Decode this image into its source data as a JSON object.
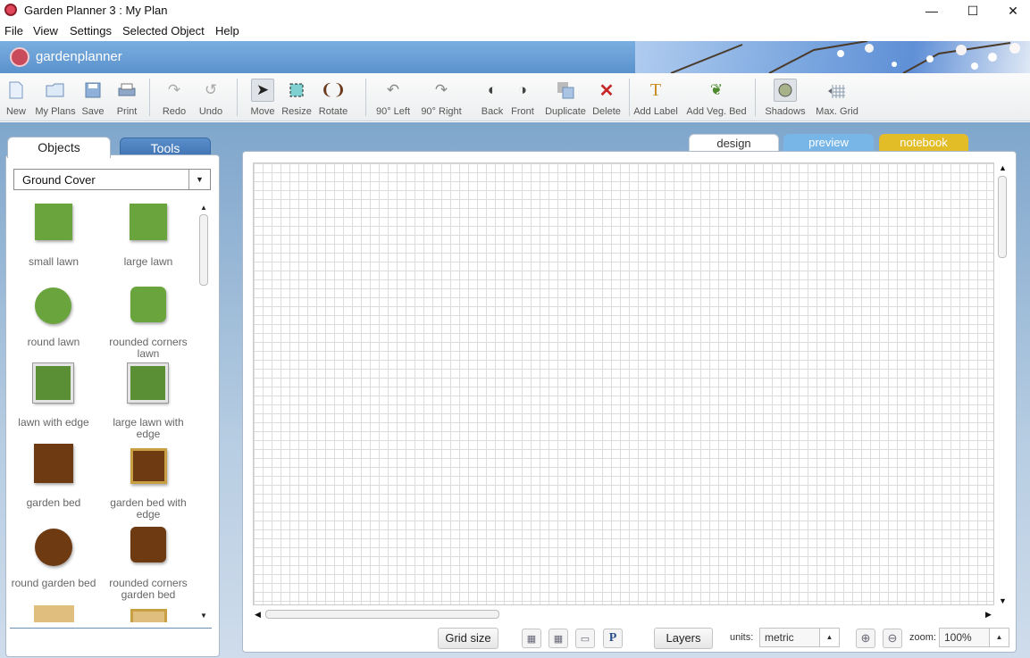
{
  "window": {
    "title": "Garden Planner 3 : My  Plan",
    "minimize": "—",
    "maximize": "☐",
    "close": "✕"
  },
  "menu": [
    "File",
    "View",
    "Settings",
    "Selected Object",
    "Help"
  ],
  "brand": {
    "name": "gardenplanner"
  },
  "toolbar": [
    {
      "label": "New",
      "icon": "new-document-icon"
    },
    {
      "label": "My Plans",
      "icon": "folder-icon"
    },
    {
      "label": "Save",
      "icon": "floppy-disk-icon"
    },
    {
      "label": "Print",
      "icon": "printer-icon"
    },
    {
      "label": "Redo",
      "icon": "redo-icon"
    },
    {
      "label": "Undo",
      "icon": "undo-icon"
    },
    {
      "label": "Move",
      "icon": "cursor-arrow-icon"
    },
    {
      "label": "Resize",
      "icon": "resize-icon"
    },
    {
      "label": "Rotate",
      "icon": "rotate-icon"
    },
    {
      "label": "90° Left",
      "icon": "rotate-left-icon"
    },
    {
      "label": "90° Right",
      "icon": "rotate-right-icon"
    },
    {
      "label": "Back",
      "icon": "send-back-icon"
    },
    {
      "label": "Front",
      "icon": "bring-front-icon"
    },
    {
      "label": "Duplicate",
      "icon": "duplicate-icon"
    },
    {
      "label": "Delete",
      "icon": "delete-x-icon"
    },
    {
      "label": "Add Label",
      "icon": "text-t-icon"
    },
    {
      "label": "Add Veg. Bed",
      "icon": "vegetable-bed-icon"
    },
    {
      "label": "Shadows",
      "icon": "shadow-circle-icon"
    },
    {
      "label": "Max. Grid",
      "icon": "max-grid-icon"
    }
  ],
  "panel_tabs": {
    "objects": "Objects",
    "tools": "Tools"
  },
  "category": {
    "selected": "Ground Cover"
  },
  "objects": [
    {
      "label": "small lawn"
    },
    {
      "label": "large lawn"
    },
    {
      "label": "round lawn"
    },
    {
      "label": "rounded corners lawn"
    },
    {
      "label": "lawn with edge"
    },
    {
      "label": "large lawn with edge"
    },
    {
      "label": "garden bed"
    },
    {
      "label": "garden bed with edge"
    },
    {
      "label": "round garden bed"
    },
    {
      "label": "rounded corners garden bed"
    }
  ],
  "view_tabs": {
    "design": "design",
    "preview": "preview",
    "notebook": "notebook"
  },
  "status": {
    "grid_size": "Grid size",
    "layers": "Layers",
    "units_label": "units:",
    "units_value": "metric",
    "zoom_label": "zoom:",
    "zoom_value": "100%",
    "p_toggle": "P"
  },
  "colors": {
    "accent": "#3f73b3",
    "preview_tab": "#78b6e8",
    "notebook_tab": "#e2bd28",
    "lawn": "#6aa43c",
    "bed": "#6e3a12",
    "delete": "#c62828"
  }
}
